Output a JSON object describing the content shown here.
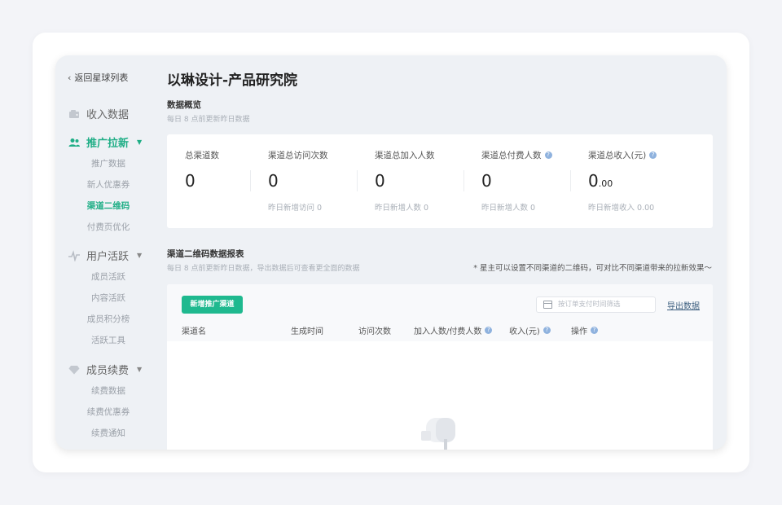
{
  "sidebar": {
    "back_label": "返回星球列表",
    "groups": [
      {
        "label": "收入数据",
        "icon": "wallet-icon",
        "items": []
      },
      {
        "label": "推广拉新",
        "icon": "users-icon",
        "items": [
          "推广数据",
          "新人优惠券",
          "渠道二维码",
          "付费页优化"
        ]
      },
      {
        "label": "用户活跃",
        "icon": "pulse-icon",
        "items": [
          "成员活跃",
          "内容活跃",
          "成员积分榜",
          "活跃工具"
        ]
      },
      {
        "label": "成员续费",
        "icon": "diamond-icon",
        "items": [
          "续费数据",
          "续费优惠券",
          "续费通知"
        ]
      }
    ],
    "active_item": "渠道二维码"
  },
  "page": {
    "title": "以琳设计-产品研究院"
  },
  "overview": {
    "title": "数据概览",
    "subtitle": "每日 8 点前更新昨日数据",
    "stats": [
      {
        "label": "总渠道数",
        "value": "0",
        "sub": ""
      },
      {
        "label": "渠道总访问次数",
        "value": "0",
        "sub": "昨日新增访问 0"
      },
      {
        "label": "渠道总加入人数",
        "value": "0",
        "sub": "昨日新增人数 0"
      },
      {
        "label": "渠道总付费人数",
        "value": "0",
        "sub": "昨日新增人数 0"
      },
      {
        "label": "渠道总收入(元)",
        "value": "0",
        "value_decimal": ".00",
        "sub": "昨日新增收入 0.00"
      }
    ]
  },
  "report": {
    "title": "渠道二维码数据报表",
    "subtitle": "每日 8 点前更新昨日数据，导出数据后可查看更全面的数据",
    "note": "* 星主可以设置不同渠道的二维码，可对比不同渠道带来的拉新效果～",
    "add_button": "新增推广渠道",
    "filter_placeholder": "按订单支付时间筛选",
    "export_label": "导出数据",
    "columns": [
      "渠道名",
      "生成时间",
      "访问次数",
      "加入人数/付费人数",
      "收入(元)",
      "操作"
    ]
  },
  "colors": {
    "accent": "#1fb98f",
    "help": "#8fb2de"
  }
}
